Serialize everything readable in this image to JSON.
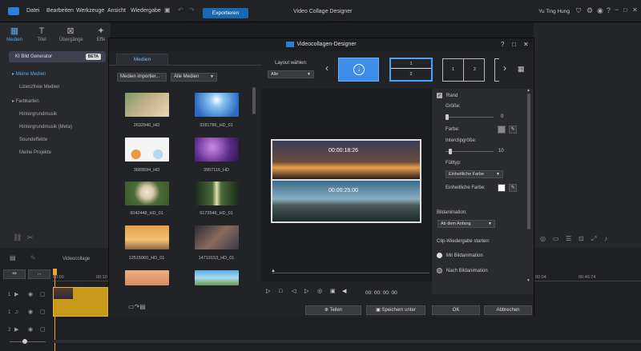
{
  "topbar": {
    "menu": [
      "Datei",
      "Bearbeiten",
      "Werkzeuge",
      "Ansicht",
      "Wiedergabe"
    ],
    "export_label": "Exportieren",
    "app_title": "Video Collage Designer",
    "user": "Yu Ting Hung"
  },
  "left_panel": {
    "tabs": [
      "Medien",
      "Titel",
      "Übergänge",
      "Effe"
    ],
    "ai_generator": "KI Bild Generator",
    "beta": "BETA",
    "tree": [
      "Meine Medien",
      "Lizenzfreie Medien",
      "Farbkarten",
      "Hintergrundmusik",
      "Hintergrundmusik (Meta)",
      "Soundeffekte",
      "Meine Projekte"
    ]
  },
  "timeline": {
    "label": "Videocollage",
    "time_start": "00:00",
    "time_mid": "00:10",
    "time_right1": "00:04",
    "time_right2": "00:46:74",
    "tracks": [
      "1",
      "1",
      "2"
    ]
  },
  "dialog": {
    "title": "Videocollagen-Designer",
    "media_tab": "Medien",
    "import_btn": "Medien importier...",
    "filter_btn": "Alle Medien",
    "thumbnails": [
      {
        "label": "2632940_HD"
      },
      {
        "label": "3281786_HD_01"
      },
      {
        "label": "3689594_HD"
      },
      {
        "label": "3957116_HD"
      },
      {
        "label": "9042448_HD_01"
      },
      {
        "label": "9173546_HD_01"
      },
      {
        "label": "12515060_HD_01"
      },
      {
        "label": "14719153_HD_01"
      },
      {
        "label": ""
      },
      {
        "label": ""
      }
    ],
    "layout_label": "Layout wählen:",
    "layout_filter": "Alle",
    "layout_cells": [
      "1",
      "2",
      "1",
      "2"
    ],
    "preview_time1": "00:00:18:26",
    "preview_time2": "00:00:25:00",
    "player_time": "00: 00: 00: 00",
    "props": {
      "border": "Rand",
      "size_label": "Größe:",
      "size_value": "0",
      "color_label": "Farbe:",
      "interclip_label": "Interclipgröße:",
      "interclip_value": "10",
      "fill_label": "Fülltyp:",
      "fill_value": "Einheitliche Farbe",
      "unicolor_label": "Einheitliche Farbe:",
      "anim_label": "Bildanimation:",
      "anim_value": "Ab dem Anfang",
      "playback_label": "Clip-Wiedergabe starten:",
      "opt1": "Mit Bildanimation",
      "opt2": "Nach Bildanimation"
    },
    "footer": {
      "share": "Teilen",
      "save_as": "Speichern unter",
      "ok": "OK",
      "cancel": "Abbrechen"
    }
  }
}
